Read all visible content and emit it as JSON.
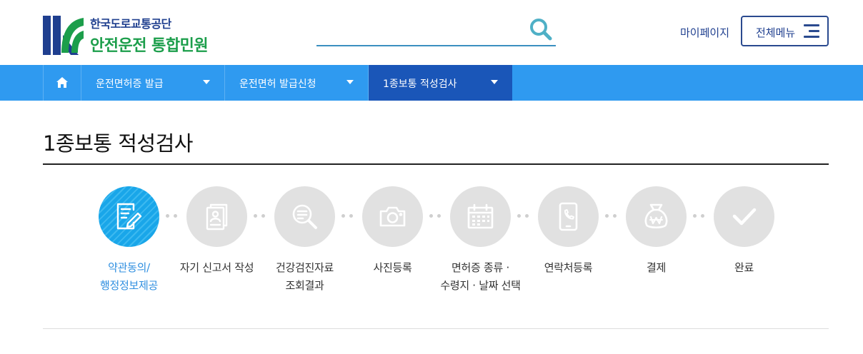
{
  "header": {
    "logo_top": "한국도로교통공단",
    "logo_bottom": "안전운전 통합민원",
    "search": {
      "value": "",
      "placeholder": ""
    },
    "mypage_label": "마이페이지",
    "menu_label": "전체메뉴"
  },
  "nav": {
    "home_icon": "home-icon",
    "items": [
      {
        "label": "운전면허증 발급"
      },
      {
        "label": "운전면허 발급신청"
      },
      {
        "label": "1종보통 적성검사"
      }
    ]
  },
  "page": {
    "title": "1종보통 적성검사"
  },
  "steps": [
    {
      "line1": "약관동의/",
      "line2": "행정정보제공",
      "icon": "document-sign-icon",
      "active": true
    },
    {
      "line1": "자기 신고서 작성",
      "line2": "",
      "icon": "self-report-icon",
      "active": false
    },
    {
      "line1": "건강검진자료",
      "line2": "조회결과",
      "icon": "magnifier-icon",
      "active": false
    },
    {
      "line1": "사진등록",
      "line2": "",
      "icon": "camera-icon",
      "active": false
    },
    {
      "line1": "면허증 종류 ·",
      "line2": "수령지 · 날짜 선택",
      "icon": "calendar-icon",
      "active": false
    },
    {
      "line1": "연락처등록",
      "line2": "",
      "icon": "phone-icon",
      "active": false
    },
    {
      "line1": "결제",
      "line2": "",
      "icon": "won-bag-icon",
      "active": false
    },
    {
      "line1": "완료",
      "line2": "",
      "icon": "check-icon",
      "active": false
    }
  ],
  "colors": {
    "nav_bar": "#2f9af0",
    "nav_active": "#1a56b8",
    "brand_navy": "#1f3f8f",
    "brand_green": "#1c9e4b",
    "step_active": "#19a6e9",
    "step_inactive": "#e1e1e1"
  }
}
